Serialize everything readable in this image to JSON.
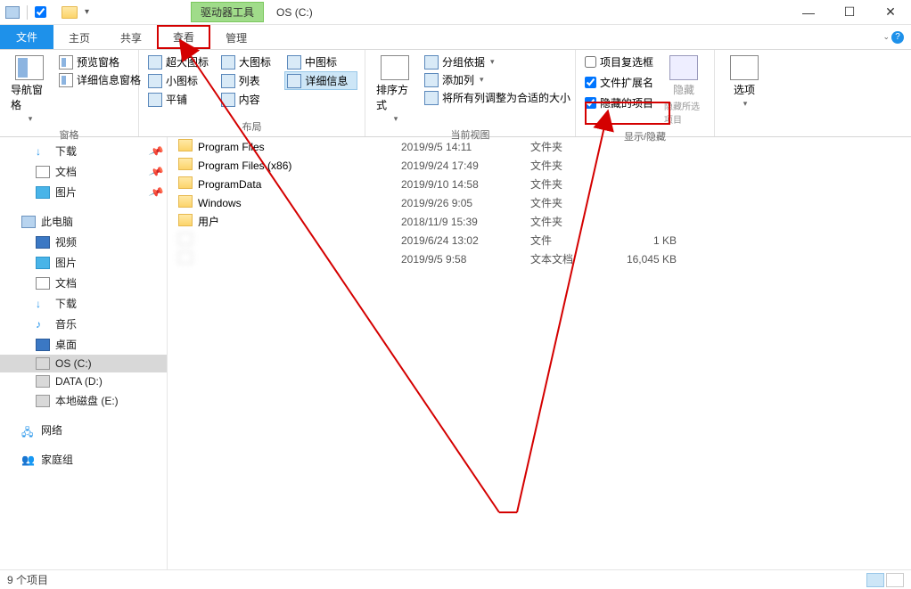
{
  "titlebar": {
    "context_tab": "驱动器工具",
    "title": "OS (C:)"
  },
  "ribbon_tabs": {
    "file": "文件",
    "home": "主页",
    "share": "共享",
    "view": "查看",
    "manage": "管理"
  },
  "ribbon": {
    "pane_group": {
      "nav": "导航窗格",
      "preview": "预览窗格",
      "details": "详细信息窗格",
      "label": "窗格"
    },
    "layout_group": {
      "xl_icons": "超大图标",
      "l_icons": "大图标",
      "m_icons": "中图标",
      "s_icons": "小图标",
      "list": "列表",
      "details": "详细信息",
      "tiles": "平铺",
      "content": "内容",
      "label": "布局"
    },
    "current_view": {
      "sort": "排序方式",
      "group_by": "分组依据",
      "add_columns": "添加列",
      "fit_columns": "将所有列调整为合适的大小",
      "label": "当前视图"
    },
    "show_hide": {
      "item_checkboxes": "项目复选框",
      "file_ext": "文件扩展名",
      "hidden_items": "隐藏的项目",
      "hide_selected": "隐藏所选项目",
      "hide_btn": "隐藏",
      "label": "显示/隐藏"
    },
    "options": {
      "btn": "选项"
    }
  },
  "sidebar": {
    "items": [
      {
        "label": "下载",
        "kind": "dl",
        "pinned": true,
        "lvl": 2
      },
      {
        "label": "文档",
        "kind": "doc",
        "pinned": true,
        "lvl": 2
      },
      {
        "label": "图片",
        "kind": "pic",
        "pinned": true,
        "lvl": 2
      },
      {
        "label": "",
        "kind": "spacer"
      },
      {
        "label": "此电脑",
        "kind": "pc",
        "lvl": 1
      },
      {
        "label": "视频",
        "kind": "vid",
        "lvl": 2
      },
      {
        "label": "图片",
        "kind": "pic",
        "lvl": 2
      },
      {
        "label": "文档",
        "kind": "doc",
        "lvl": 2
      },
      {
        "label": "下载",
        "kind": "dl",
        "lvl": 2
      },
      {
        "label": "音乐",
        "kind": "mus",
        "lvl": 2
      },
      {
        "label": "桌面",
        "kind": "desk",
        "lvl": 2
      },
      {
        "label": "OS (C:)",
        "kind": "drive",
        "lvl": 2,
        "selected": true
      },
      {
        "label": "DATA (D:)",
        "kind": "drive",
        "lvl": 2
      },
      {
        "label": "本地磁盘 (E:)",
        "kind": "drive",
        "lvl": 2
      },
      {
        "label": "",
        "kind": "spacer"
      },
      {
        "label": "网络",
        "kind": "net",
        "lvl": 1
      },
      {
        "label": "",
        "kind": "spacer"
      },
      {
        "label": "家庭组",
        "kind": "hg",
        "lvl": 1
      }
    ]
  },
  "files": [
    {
      "name": "Program Files",
      "date": "2019/9/5 14:11",
      "type": "文件夹",
      "size": "",
      "icon": "folder"
    },
    {
      "name": "Program Files (x86)",
      "date": "2019/9/24 17:49",
      "type": "文件夹",
      "size": "",
      "icon": "folder"
    },
    {
      "name": "ProgramData",
      "date": "2019/9/10 14:58",
      "type": "文件夹",
      "size": "",
      "icon": "folder"
    },
    {
      "name": "Windows",
      "date": "2019/9/26 9:05",
      "type": "文件夹",
      "size": "",
      "icon": "folder"
    },
    {
      "name": "用户",
      "date": "2018/11/9 15:39",
      "type": "文件夹",
      "size": "",
      "icon": "folder"
    },
    {
      "name": " ",
      "date": "2019/6/24 13:02",
      "type": "文件",
      "size": "1 KB",
      "icon": "file",
      "blur": true
    },
    {
      "name": " ",
      "date": "2019/9/5 9:58",
      "type": "文本文档",
      "size": "16,045 KB",
      "icon": "file",
      "blur": true
    }
  ],
  "status": {
    "count": "9 个项目"
  },
  "checkboxes": {
    "item_checkboxes": false,
    "file_ext": true,
    "hidden_items": true
  }
}
